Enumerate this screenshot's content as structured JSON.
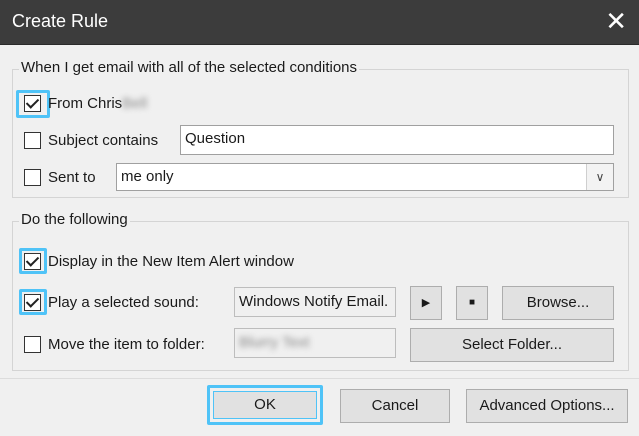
{
  "window": {
    "title": "Create Rule",
    "close_icon": "close-icon"
  },
  "conditions": {
    "group_label": "When I get email with all of the selected conditions",
    "from_label": "From Chris",
    "from_blurred": "Bell",
    "from_checked": true,
    "subject_label": "Subject contains",
    "subject_value": "Question",
    "subject_checked": false,
    "sentto_label": "Sent to",
    "sentto_value": "me only",
    "sentto_checked": false
  },
  "actions": {
    "group_label": "Do the following",
    "display_label": "Display in the New Item Alert window",
    "display_checked": true,
    "sound_label": "Play a selected sound:",
    "sound_value": "Windows Notify Email.",
    "sound_checked": true,
    "play_icon": "play-icon",
    "stop_icon": "stop-icon",
    "browse_label": "Browse...",
    "move_label": "Move the item to folder:",
    "move_value": "Blurry Text",
    "move_checked": false,
    "select_folder_label": "Select Folder..."
  },
  "footer": {
    "ok_label": "OK",
    "cancel_label": "Cancel",
    "advanced_label": "Advanced Options..."
  },
  "colors": {
    "titlebar": "#3c3c3c",
    "highlight": "#4fc3f7",
    "background": "#f0f0f0"
  }
}
